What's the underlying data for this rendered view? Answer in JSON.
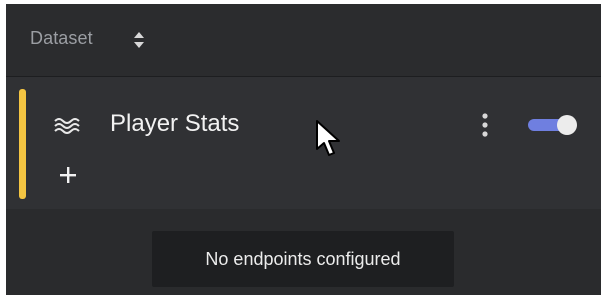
{
  "header": {
    "label": "Dataset",
    "sort_icon": "sort-up-down-icon"
  },
  "row": {
    "title": "Player Stats",
    "accent_color": "#f4c542",
    "icon": "wave-icon",
    "add_icon": "plus-icon",
    "menu_icon": "kebab-menu-icon",
    "toggle": {
      "state": "on",
      "color": "#6f7fe0"
    }
  },
  "empty_state": {
    "message": "No endpoints configured"
  },
  "colors": {
    "panel_bg": "#2a2b2d",
    "row_bg": "#303134",
    "header_text": "#9b9ea3",
    "text": "#f2f2f2"
  }
}
